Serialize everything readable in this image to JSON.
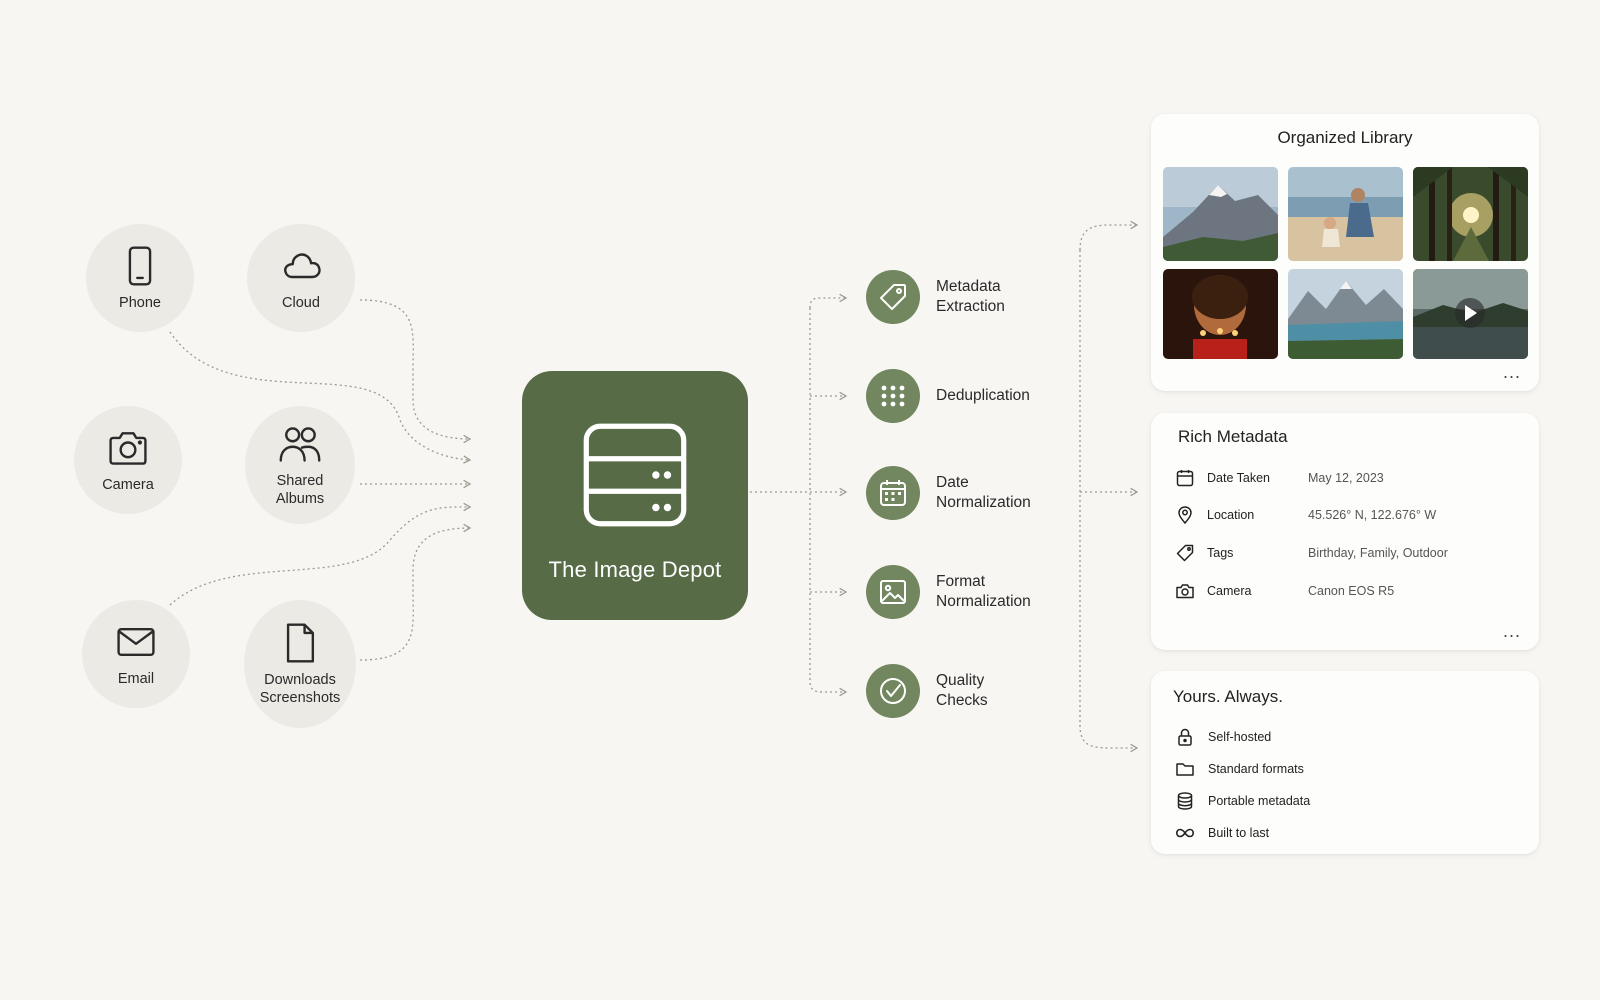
{
  "colors": {
    "background": "#f7f6f2",
    "hub": "#566b46",
    "step_disc": "#72875f",
    "bubble": "#ebeae5",
    "connector": "#9a9a90"
  },
  "sources": [
    {
      "id": "phone",
      "label": "Phone",
      "icon": "phone-icon"
    },
    {
      "id": "cloud",
      "label": "Cloud",
      "icon": "cloud-icon"
    },
    {
      "id": "camera",
      "label": "Camera",
      "icon": "camera-icon"
    },
    {
      "id": "shared",
      "label_line1": "Shared",
      "label_line2": "Albums",
      "icon": "users-icon"
    },
    {
      "id": "email",
      "label": "Email",
      "icon": "mail-icon"
    },
    {
      "id": "downloads",
      "label_line1": "Downloads",
      "label_line2": "Screenshots",
      "icon": "document-icon"
    }
  ],
  "hub": {
    "title": "The Image Depot",
    "icon": "server-icon"
  },
  "steps": [
    {
      "line1": "Metadata",
      "line2": "Extraction",
      "icon": "tag-icon"
    },
    {
      "line1": "Deduplication",
      "line2": "",
      "icon": "dot-grid-icon"
    },
    {
      "line1": "Date",
      "line2": "Normalization",
      "icon": "calendar-icon"
    },
    {
      "line1": "Format",
      "line2": "Normalization",
      "icon": "image-icon"
    },
    {
      "line1": "Quality",
      "line2": "Checks",
      "icon": "check-circle-icon"
    }
  ],
  "library": {
    "title": "Organized Library",
    "thumbnails": [
      "mountain-peak",
      "mother-child-beach",
      "forest-sunlight",
      "birthday-candles",
      "alpine-lake",
      "lake-sunset-video"
    ],
    "more": "..."
  },
  "metadata": {
    "title": "Rich Metadata",
    "rows": [
      {
        "key": "Date Taken",
        "value": "May 12, 2023",
        "icon": "calendar-icon"
      },
      {
        "key": "Location",
        "value": "45.526° N,  122.676° W",
        "icon": "pin-icon"
      },
      {
        "key": "Tags",
        "value": "Birthday, Family, Outdoor",
        "icon": "tag-icon"
      },
      {
        "key": "Camera",
        "value": "Canon EOS R5",
        "icon": "camera-icon"
      }
    ],
    "more": "..."
  },
  "yours": {
    "title": "Yours. Always.",
    "items": [
      {
        "label": "Self-hosted",
        "icon": "lock-icon"
      },
      {
        "label": "Standard formats",
        "icon": "folder-icon"
      },
      {
        "label": "Portable metadata",
        "icon": "database-icon"
      },
      {
        "label": "Built to last",
        "icon": "infinity-icon"
      }
    ]
  }
}
